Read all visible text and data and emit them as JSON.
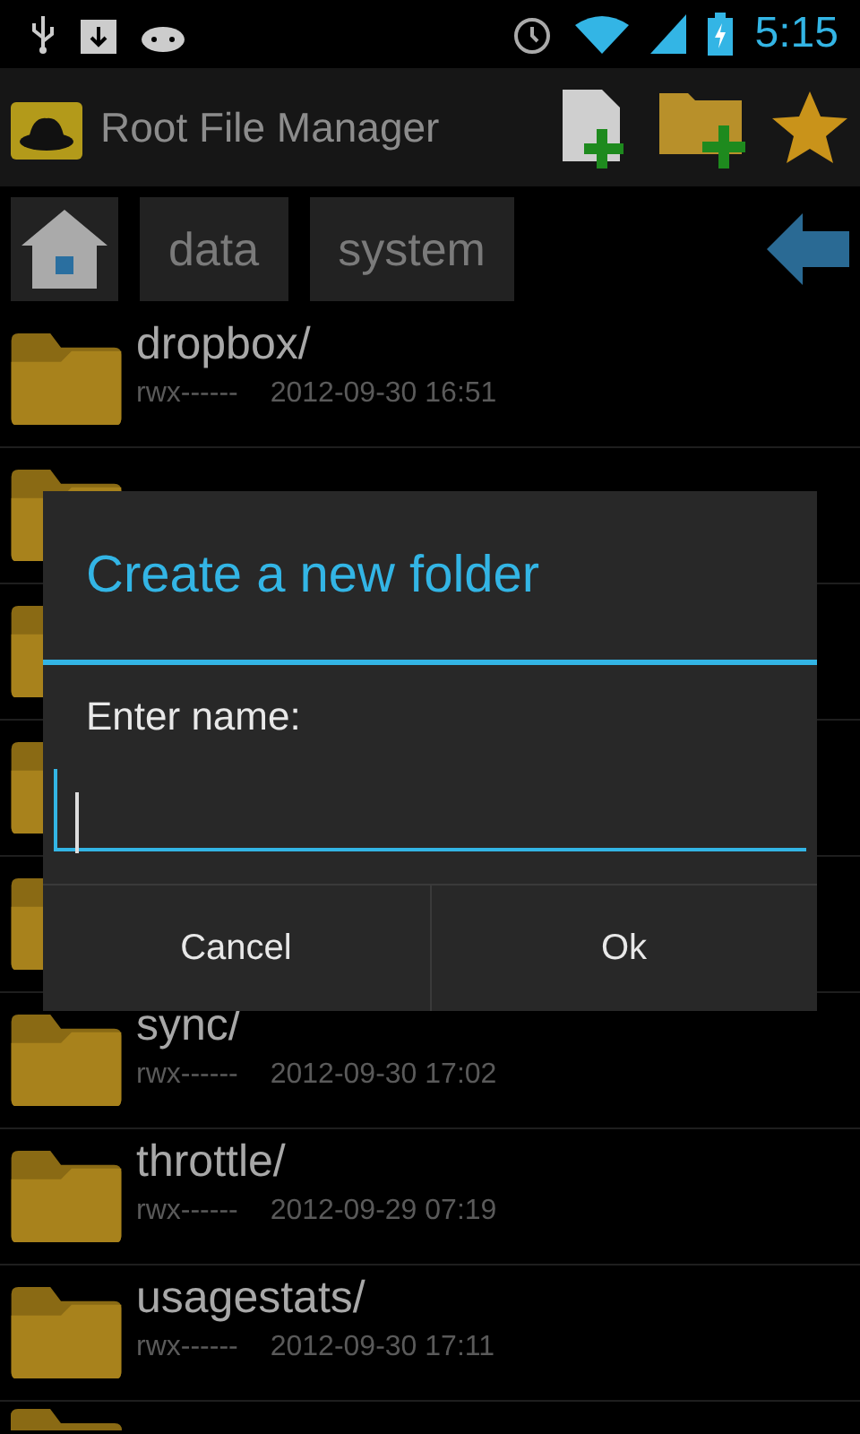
{
  "status_bar": {
    "time": "5:15"
  },
  "action_bar": {
    "title": "Root File Manager"
  },
  "breadcrumbs": [
    {
      "kind": "home"
    },
    {
      "kind": "text",
      "label": "data"
    },
    {
      "kind": "text",
      "label": "system"
    }
  ],
  "files": [
    {
      "kind": "full",
      "name": "dropbox/",
      "permissions": "rwx------",
      "modified": "2012-09-30 16:51"
    },
    {
      "kind": "covered"
    },
    {
      "kind": "covered"
    },
    {
      "kind": "covered"
    },
    {
      "kind": "covered"
    },
    {
      "kind": "full",
      "name": "sync/",
      "permissions": "rwx------",
      "modified": "2012-09-30 17:02"
    },
    {
      "kind": "full",
      "name": "throttle/",
      "permissions": "rwx------",
      "modified": "2012-09-29 07:19"
    },
    {
      "kind": "full",
      "name": "usagestats/",
      "permissions": "rwx------",
      "modified": "2012-09-30 17:11"
    },
    {
      "kind": "edge"
    }
  ],
  "dialog": {
    "title": "Create a new folder",
    "label": "Enter name:",
    "buttons": [
      "Cancel",
      "Ok"
    ]
  }
}
